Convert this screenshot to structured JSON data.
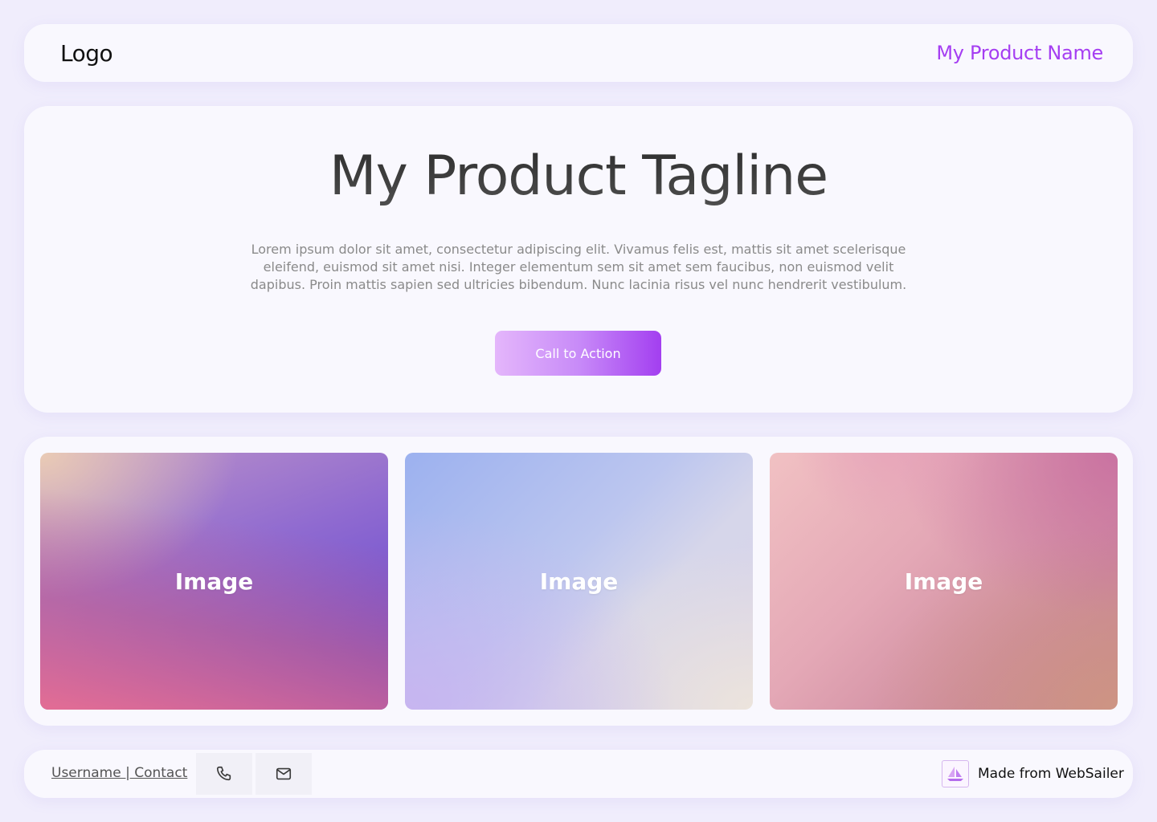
{
  "header": {
    "logo": "Logo",
    "product_name": "My Product Name"
  },
  "hero": {
    "tagline": "My Product Tagline",
    "description": "Lorem ipsum dolor sit amet, consectetur adipiscing elit. Vivamus felis est, mattis sit amet scelerisque eleifend, euismod sit amet nisi. Integer elementum sem sit amet sem faucibus, non euismod velit dapibus. Proin mattis sapien sed ultricies bibendum. Nunc lacinia risus vel nunc hendrerit vestibulum.",
    "cta_label": "Call to Action"
  },
  "gallery": {
    "tiles": [
      {
        "label": "Image"
      },
      {
        "label": "Image"
      },
      {
        "label": "Image"
      }
    ]
  },
  "footer": {
    "contact_text": "Username | Contact",
    "phone_icon": "phone-icon",
    "mail_icon": "mail-icon",
    "brand_icon": "sailboat-icon",
    "made_from": "Made from WebSailer"
  },
  "colors": {
    "accent": "#a53ef2",
    "background": "#f0edfc",
    "card": "#f9f8fe"
  }
}
